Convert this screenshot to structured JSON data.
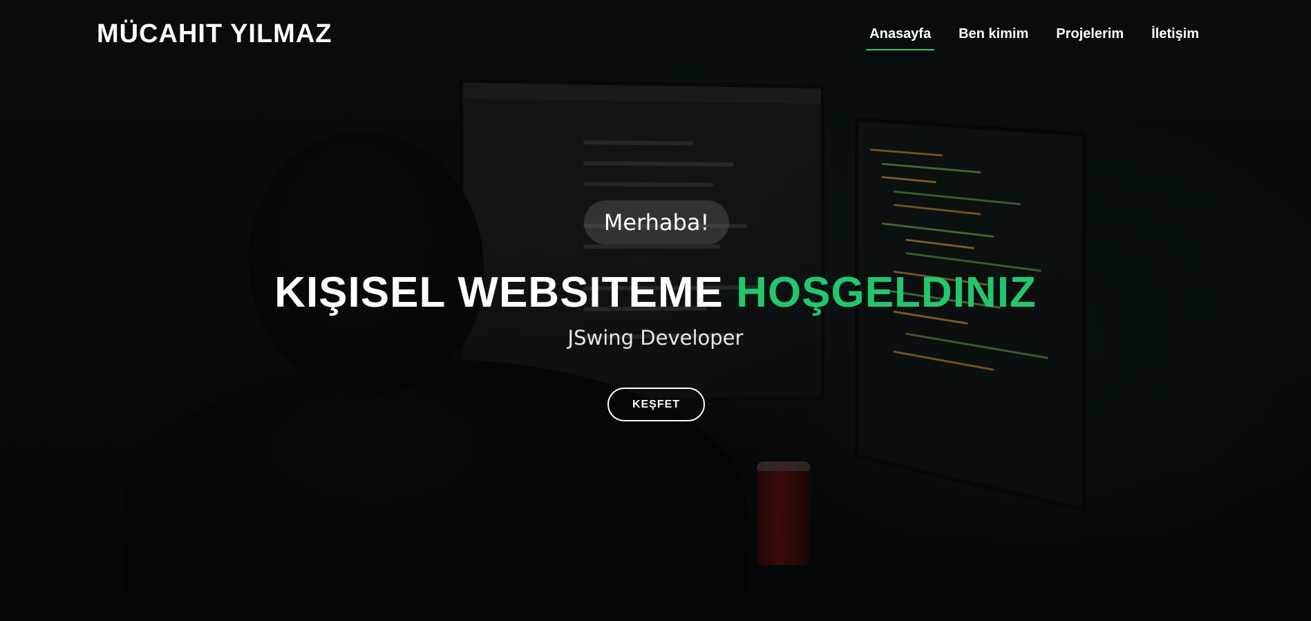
{
  "header": {
    "brand": "MÜCAHIT YILMAZ",
    "nav": [
      {
        "label": "Anasayfa",
        "active": true
      },
      {
        "label": "Ben kimim",
        "active": false
      },
      {
        "label": "Projelerim",
        "active": false
      },
      {
        "label": "İletişim",
        "active": false
      }
    ]
  },
  "hero": {
    "greeting": "Merhaba!",
    "headline_main": "KIŞISEL WEBSITEME",
    "headline_accent": "HOŞGELDINIZ",
    "subtitle": "JSwing Developer",
    "cta_label": "KEŞFET"
  },
  "colors": {
    "accent": "#22c76d",
    "nav_underline": "#2ecc71",
    "text": "#ffffff",
    "background": "#0a1213"
  }
}
